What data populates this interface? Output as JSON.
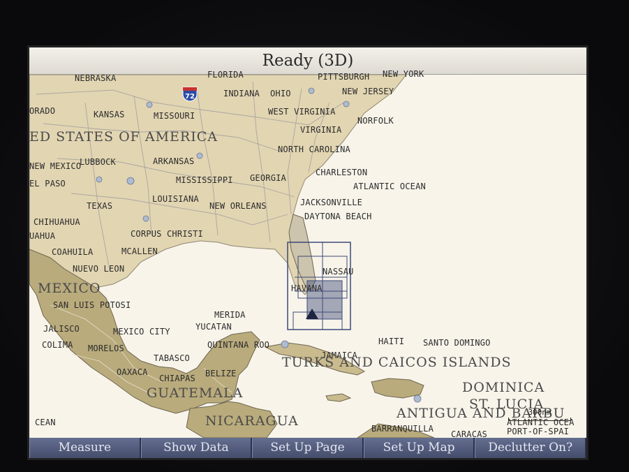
{
  "status": {
    "title": "Ready (3D)"
  },
  "map": {
    "highway_shield": "72",
    "scale_label": "300nm",
    "labels": [
      "NEBRASKA",
      "FLORIDA",
      "PITTSBURGH",
      "NEW YORK",
      "INDIANA",
      "OHIO",
      "NEW JERSEY",
      "ORADO",
      "KANSAS",
      "MISSOURI",
      "WEST VIRGINIA",
      "NORFOLK",
      "VIRGINIA",
      "NORTH CAROLINA",
      "NEW MEXICO",
      "LUBBOCK",
      "ARKANSAS",
      "CHARLESTON",
      "EL PASO",
      "MISSISSIPPI",
      "GEORGIA",
      "ATLANTIC OCEAN",
      "TEXAS",
      "LOUISIANA",
      "NEW ORLEANS",
      "JACKSONVILLE",
      "DAYTONA BEACH",
      "CHIHUAHUA",
      "CORPUS CHRISTI",
      "UAHUA",
      "COAHUILA",
      "MCALLEN",
      "NUEVO LEON",
      "NASSAU",
      "HAVANA",
      "SAN LUIS POTOSI",
      "MERIDA",
      "YUCATAN",
      "JALISCO",
      "MEXICO CITY",
      "COLIMA",
      "MORELOS",
      "QUINTANA ROO",
      "HAITI",
      "SANTO DOMINGO",
      "TABASCO",
      "JAMAICA",
      "OAXACA",
      "BELIZE",
      "CHIAPAS",
      "CEAN",
      "BARRANQUILLA",
      "CARACAS",
      "ATLANTIC OCEA",
      "PORT-OF-SPAI"
    ],
    "big_labels": [
      "ED STATES OF AMERICA",
      "MEXICO",
      "TURKS AND CAICOS ISLANDS",
      "ANTIGUA AND BARBU",
      "DOMINICA",
      "ST. LUCIA",
      "GUATEMALA",
      "NICARAGUA"
    ],
    "colors": {
      "land": "#d8c9a0",
      "land_dark": "#a99a6c",
      "water": "#f8f4ea",
      "softkey": "#565f80",
      "highlight": "#3c4a78"
    }
  },
  "softkeys": [
    "Measure",
    "Show Data",
    "Set Up Page",
    "Set Up Map",
    "Declutter On?"
  ]
}
